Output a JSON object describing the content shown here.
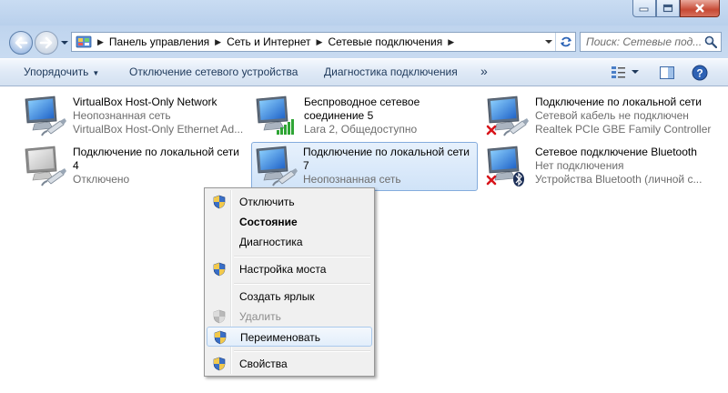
{
  "window": {
    "minimize_icon": "minimize-icon",
    "maximize_icon": "maximize-icon",
    "close_icon": "close-icon"
  },
  "address": {
    "breadcrumbs": [
      "Панель управления",
      "Сеть и Интернет",
      "Сетевые подключения"
    ]
  },
  "search": {
    "placeholder": "Поиск: Сетевые под..."
  },
  "toolbar": {
    "organize": "Упорядочить",
    "disable_device": "Отключение сетевого устройства",
    "diagnose": "Диагностика подключения",
    "more": "»"
  },
  "connections": [
    {
      "name": "VirtualBox Host-Only Network",
      "status": "Неопознанная сеть",
      "device": "VirtualBox Host-Only Ethernet Ad..."
    },
    {
      "name": "Беспроводное сетевое соединение 5",
      "name_line1": "Беспроводное сетевое",
      "name_line2": "соединение 5",
      "status": "Lara  2, Общедоступно"
    },
    {
      "name": "Подключение по локальной сети",
      "status": "Сетевой кабель не подключен",
      "device": "Realtek PCIe GBE Family Controller"
    },
    {
      "name": "Подключение по локальной сети 4",
      "name_line1": "Подключение по локальной сети",
      "name_line2": "4",
      "status": "Отключено"
    },
    {
      "name": "Подключение по локальной сети 7",
      "name_line1": "Подключение по локальной сети",
      "name_line2": "7",
      "status": "Неопознанная сеть"
    },
    {
      "name": "Сетевое подключение Bluetooth",
      "status": "Нет подключения",
      "device": "Устройства Bluetooth (личной с..."
    }
  ],
  "context_menu": {
    "items": [
      {
        "label": "Отключить"
      },
      {
        "label": "Состояние"
      },
      {
        "label": "Диагностика"
      },
      {
        "label": "Настройка моста"
      },
      {
        "label": "Создать ярлык"
      },
      {
        "label": "Удалить"
      },
      {
        "label": "Переименовать"
      },
      {
        "label": "Свойства"
      }
    ]
  },
  "colors": {
    "toolbar_text": "#1e395b",
    "secondary_text": "#6d6d6d",
    "selection_border": "#84acdd",
    "error_red": "#d8141a",
    "signal_green": "#2fa535"
  }
}
